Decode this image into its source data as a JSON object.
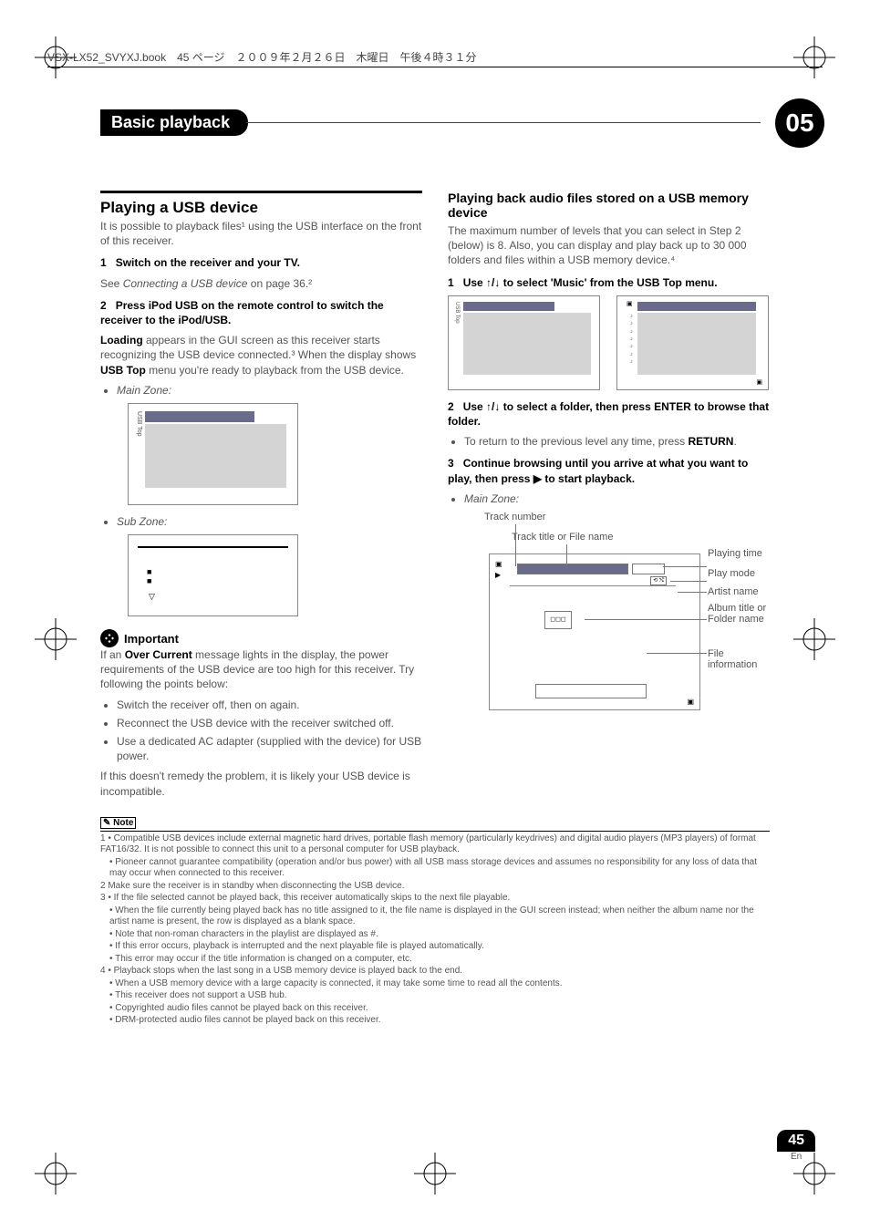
{
  "header": {
    "book_line": "VSX-LX52_SVYXJ.book　45 ページ　２００９年２月２６日　木曜日　午後４時３１分"
  },
  "chapter": {
    "title": "Basic playback",
    "number": "05"
  },
  "left": {
    "h2": "Playing a USB device",
    "intro": "It is possible to playback files¹ using the USB interface on the front of this receiver.",
    "step1_title": "Switch on the receiver and your TV.",
    "step1_text_a": "See ",
    "step1_text_italic": "Connecting a USB device",
    "step1_text_b": " on page 36.²",
    "step2_title": "Press iPod USB on the remote control to switch the receiver to the iPod/USB.",
    "step2_text_a": "Loading",
    "step2_text_b": " appears in the GUI screen as this receiver starts recognizing the USB device connected.³ When the display shows ",
    "step2_text_c": "USB Top",
    "step2_text_d": " menu you're ready to playback from the USB device.",
    "mainzone": "Main Zone:",
    "subzone": "Sub Zone:",
    "important_label": "Important",
    "important_text_a": "If an ",
    "important_text_b": "Over Current",
    "important_text_c": " message lights in the display, the power requirements of the USB device are too high for this receiver. Try following the points below:",
    "bullet1": "Switch the receiver off, then on again.",
    "bullet2": "Reconnect the USB device with the receiver switched off.",
    "bullet3": "Use a dedicated AC adapter (supplied with the device) for USB power.",
    "closing": "If this doesn't remedy the problem, it is likely your USB device is incompatible."
  },
  "right": {
    "h3": "Playing back audio files stored on a USB memory device",
    "intro": "The maximum number of levels that you can select in Step 2 (below) is 8. Also, you can display and play back up to 30 000 folders and files within a USB memory device.⁴",
    "step1_title": "Use ↑/↓ to select 'Music' from the USB Top menu.",
    "step2_title": "Use ↑/↓ to select a folder, then press ENTER to browse that folder.",
    "step2_bullet_a": "To return to the previous level any time, press ",
    "step2_bullet_b": "RETURN",
    "step2_bullet_c": ".",
    "step3_title_a": "Continue browsing until you arrive at what you want to play, then press ",
    "step3_title_b": " to start playback.",
    "mainzone": "Main Zone:",
    "callouts": {
      "track_number": "Track number",
      "track_title": "Track title or File name",
      "playing_time": "Playing time",
      "play_mode": "Play mode",
      "artist_name": "Artist name",
      "album_title": "Album title or Folder name",
      "file_info": "File information"
    }
  },
  "notes": {
    "label": "Note",
    "n1": "1 • Compatible USB devices include external magnetic hard drives, portable flash memory (particularly keydrives) and digital audio players (MP3 players) of format FAT16/32. It is not possible to connect this unit to a personal computer for USB playback.",
    "n1b": "• Pioneer cannot guarantee compatibility (operation and/or bus power) with all USB mass storage devices and assumes no responsibility for any loss of data that may occur when connected to this receiver.",
    "n2": "2 Make sure the receiver is in standby when disconnecting the USB device.",
    "n3": "3 • If the file selected cannot be played back, this receiver automatically skips to the next file playable.",
    "n3b": "• When the file currently being played back has no title assigned to it, the file name is displayed in the GUI screen instead; when neither the album name nor the artist name is present, the row is displayed as a blank space.",
    "n3c": "• Note that non-roman characters in the playlist are displayed as #.",
    "n3d": "• If this error occurs, playback is interrupted and the next playable file is played automatically.",
    "n3e": "• This error may occur if the title information is changed on a computer, etc.",
    "n4": "4 • Playback stops when the last song in a USB memory device is played back to the end.",
    "n4b": "• When a USB memory device with a large capacity is connected, it may take some time to read all the contents.",
    "n4c": "• This receiver does not support a USB hub.",
    "n4d": "• Copyrighted audio files cannot be played back on this receiver.",
    "n4e": "• DRM-protected audio files cannot be played back on this receiver."
  },
  "page": {
    "num": "45",
    "lang": "En"
  },
  "steps": {
    "s1": "1",
    "s2": "2",
    "s3": "3"
  }
}
